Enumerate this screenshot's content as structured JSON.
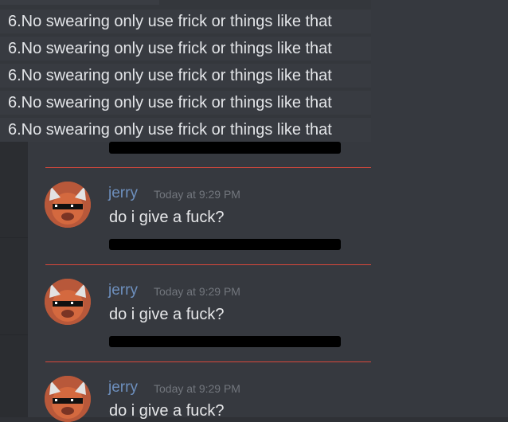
{
  "rules": [
    "6.No swearing only use frick or things like that",
    "6.No swearing only use frick or things like that",
    "6.No swearing only use frick or things like that",
    "6.No swearing only use frick or things like that",
    "6.No swearing only use frick or things like that"
  ],
  "messages": [
    {
      "username": "jerry",
      "timestamp": "Today at 9:29 PM",
      "text": "do i give a fuck?"
    },
    {
      "username": "jerry",
      "timestamp": "Today at 9:29 PM",
      "text": "do i give a fuck?"
    },
    {
      "username": "jerry",
      "timestamp": "Today at 9:29 PM",
      "text": "do i give a fuck?"
    }
  ],
  "colors": {
    "background": "#36393f",
    "username": "#6d8fbd",
    "divider": "#d9483b",
    "redaction": "#000000"
  },
  "icons": {
    "avatar": "fox-with-pixel-sunglasses-avatar"
  }
}
